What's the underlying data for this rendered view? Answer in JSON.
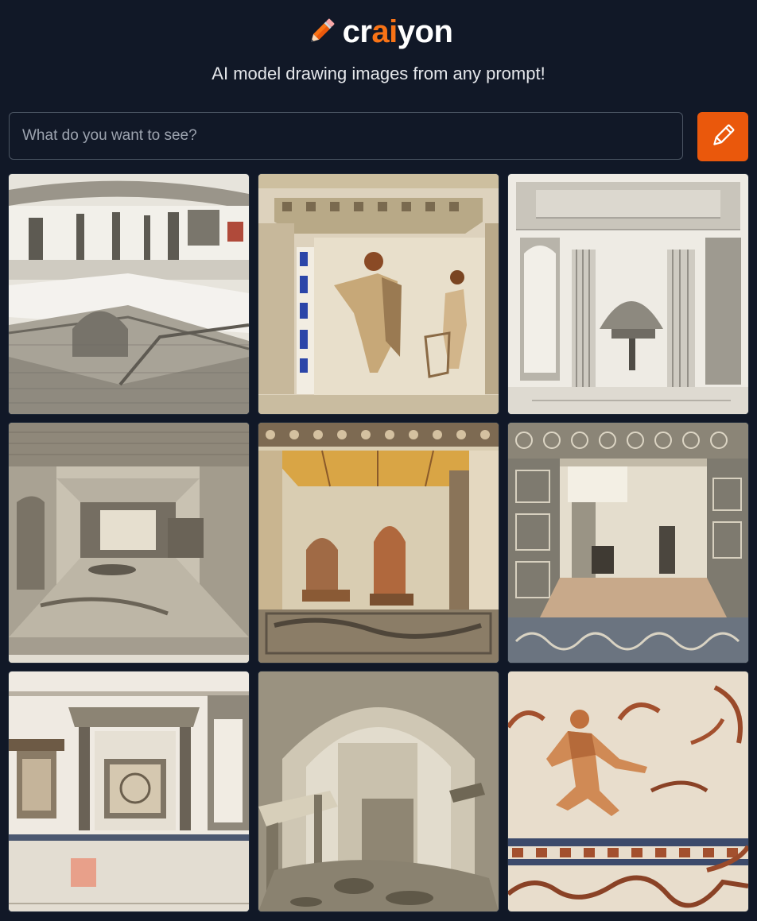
{
  "header": {
    "logo_icon": "pencil-icon",
    "logo_prefix": "cr",
    "logo_accent": "ai",
    "logo_suffix": "yon",
    "accent_color": "#f97316"
  },
  "tagline": "AI model drawing images from any prompt!",
  "search": {
    "placeholder": "What do you want to see?",
    "value": "",
    "button_icon": "pencil-icon",
    "button_color": "#ea580c"
  },
  "results": [
    {
      "subject": "sketch of roman ruins with low stone walls"
    },
    {
      "subject": "mosaic of two figures in an arched frame"
    },
    {
      "subject": "engraving of a temple interior with columns"
    },
    {
      "subject": "engraving of a vaulted stone chamber"
    },
    {
      "subject": "painted fresco of a room with arches"
    },
    {
      "subject": "mosaic interior with ornate borders"
    },
    {
      "subject": "drawing of a wall with framed panels"
    },
    {
      "subject": "sketch of an arched stone doorway"
    },
    {
      "subject": "mosaic of a running figure"
    }
  ]
}
